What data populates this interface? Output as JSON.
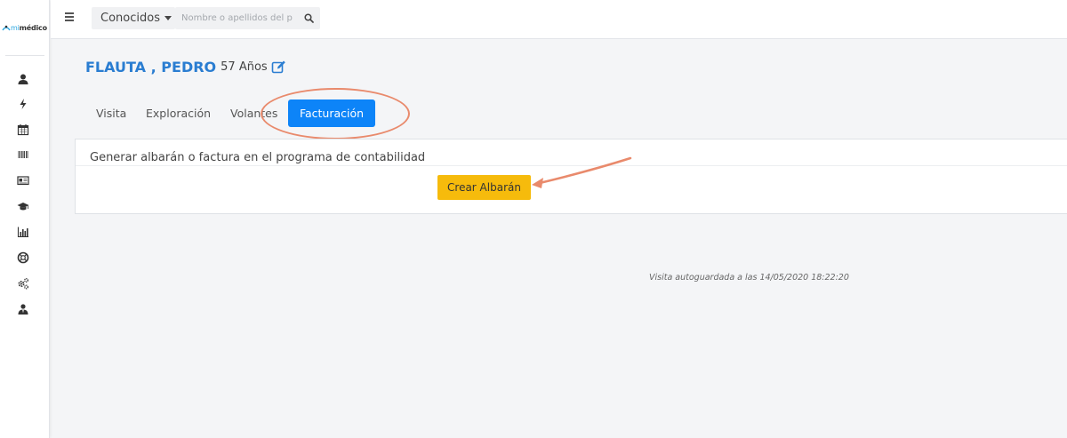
{
  "app": {
    "logo_prefix": "mi",
    "logo_main": "médico",
    "accent_color": "#0d84f8",
    "brand_color": "#2aa6e0"
  },
  "sidebar": {
    "icons": [
      {
        "name": "user-icon"
      },
      {
        "name": "bolt-icon"
      },
      {
        "name": "calendar-icon"
      },
      {
        "name": "barcode-icon"
      },
      {
        "name": "id-card-icon"
      },
      {
        "name": "graduation-cap-icon"
      },
      {
        "name": "bar-chart-icon"
      },
      {
        "name": "lifebuoy-icon"
      },
      {
        "name": "cogs-icon"
      },
      {
        "name": "user-tie-icon"
      }
    ]
  },
  "topbar": {
    "menu_icon": "hamburger-icon",
    "dropdown_label": "Conocidos",
    "search_placeholder": "Nombre o apellidos del p",
    "search_value": "",
    "search_icon": "search-icon"
  },
  "patient": {
    "name": "FLAUTA , PEDRO",
    "age": "57 Años",
    "edit_icon": "edit-icon"
  },
  "tabs": [
    {
      "label": "Visita",
      "active": false
    },
    {
      "label": "Exploración",
      "active": false
    },
    {
      "label": "Volantes",
      "active": false
    },
    {
      "label": "Facturación",
      "active": true
    }
  ],
  "billing": {
    "heading": "Generar albarán o factura en el programa de contabilidad",
    "create_button_label": "Crear Albarán",
    "button_color": "#f6bb0c"
  },
  "status": {
    "autosave_text": "Visita autoguardada a las 14/05/2020 18:22:20"
  },
  "annotations": {
    "color": "#e98a6c"
  }
}
